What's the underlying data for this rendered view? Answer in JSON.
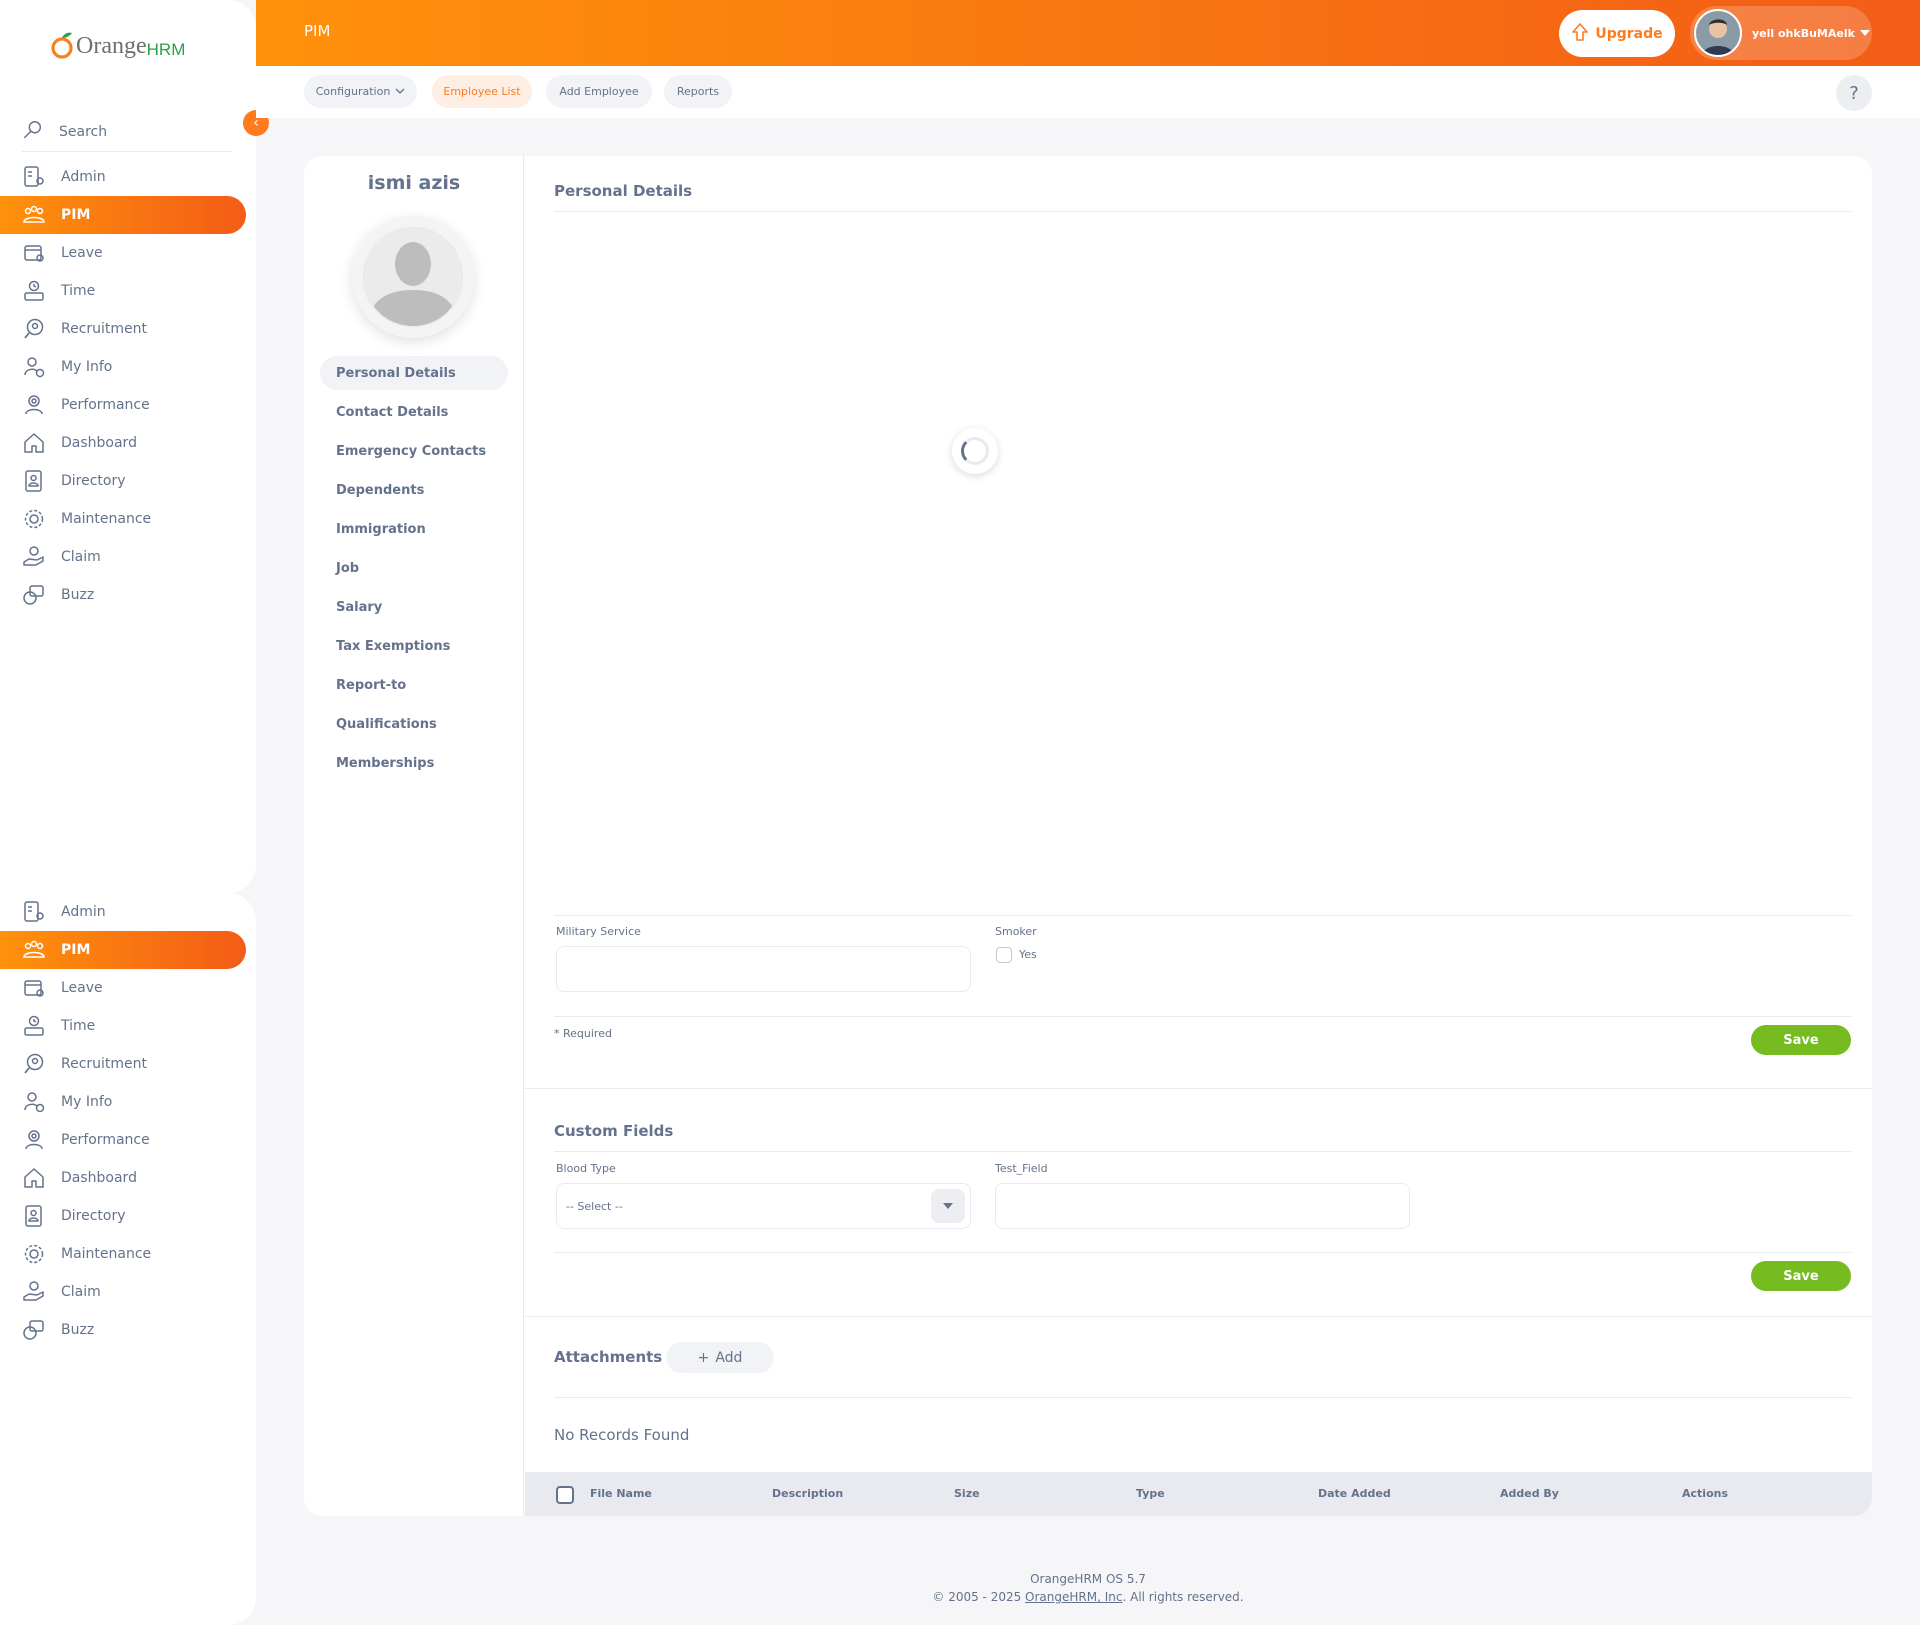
{
  "header": {
    "module_title": "PIM",
    "upgrade_label": "Upgrade",
    "user_name": "yell ohkBuMAelk"
  },
  "subnav": {
    "items": [
      {
        "label": "Configuration",
        "active": false,
        "has_dropdown": true
      },
      {
        "label": "Employee List",
        "active": true
      },
      {
        "label": "Add Employee",
        "active": false
      },
      {
        "label": "Reports",
        "active": false
      }
    ],
    "help_label": "?"
  },
  "sidebar": {
    "logo_text": "Orange",
    "logo_hrm": "HRM",
    "search_label": "Search",
    "items": [
      {
        "label": "Admin",
        "icon": "admin-icon"
      },
      {
        "label": "PIM",
        "icon": "pim-icon",
        "active": true
      },
      {
        "label": "Leave",
        "icon": "leave-icon"
      },
      {
        "label": "Time",
        "icon": "time-icon"
      },
      {
        "label": "Recruitment",
        "icon": "recruitment-icon"
      },
      {
        "label": "My Info",
        "icon": "my-info-icon"
      },
      {
        "label": "Performance",
        "icon": "performance-icon"
      },
      {
        "label": "Dashboard",
        "icon": "dashboard-icon"
      },
      {
        "label": "Directory",
        "icon": "directory-icon"
      },
      {
        "label": "Maintenance",
        "icon": "maintenance-icon"
      },
      {
        "label": "Claim",
        "icon": "claim-icon"
      },
      {
        "label": "Buzz",
        "icon": "buzz-icon"
      }
    ]
  },
  "employee": {
    "name": "ismi azis",
    "tabs": [
      {
        "label": "Personal Details",
        "active": true
      },
      {
        "label": "Contact Details"
      },
      {
        "label": "Emergency Contacts"
      },
      {
        "label": "Dependents"
      },
      {
        "label": "Immigration"
      },
      {
        "label": "Job"
      },
      {
        "label": "Salary"
      },
      {
        "label": "Tax Exemptions"
      },
      {
        "label": "Report-to"
      },
      {
        "label": "Qualifications"
      },
      {
        "label": "Memberships"
      }
    ]
  },
  "personal_details": {
    "title": "Personal Details",
    "military_label": "Military Service",
    "military_value": "",
    "smoker_label": "Smoker",
    "smoker_option": "Yes",
    "smoker_checked": false,
    "required_note": "* Required",
    "save_label": "Save"
  },
  "custom_fields": {
    "title": "Custom Fields",
    "blood_type_label": "Blood Type",
    "blood_type_value": "-- Select --",
    "test_field_label": "Test_Field",
    "test_field_value": "",
    "save_label": "Save"
  },
  "attachments": {
    "title": "Attachments",
    "add_label": "Add",
    "no_records": "No Records Found",
    "columns": [
      "File Name",
      "Description",
      "Size",
      "Type",
      "Date Added",
      "Added By",
      "Actions"
    ]
  },
  "footer": {
    "version": "OrangeHRM OS 5.7",
    "copyright_prefix": "© 2005 - 2025 ",
    "company_link": "OrangeHRM, Inc",
    "copyright_suffix": ". All rights reserved."
  },
  "colors": {
    "brand_orange": "#ff7b1d",
    "save_green": "#76bc21",
    "text_gray": "#64728c"
  }
}
